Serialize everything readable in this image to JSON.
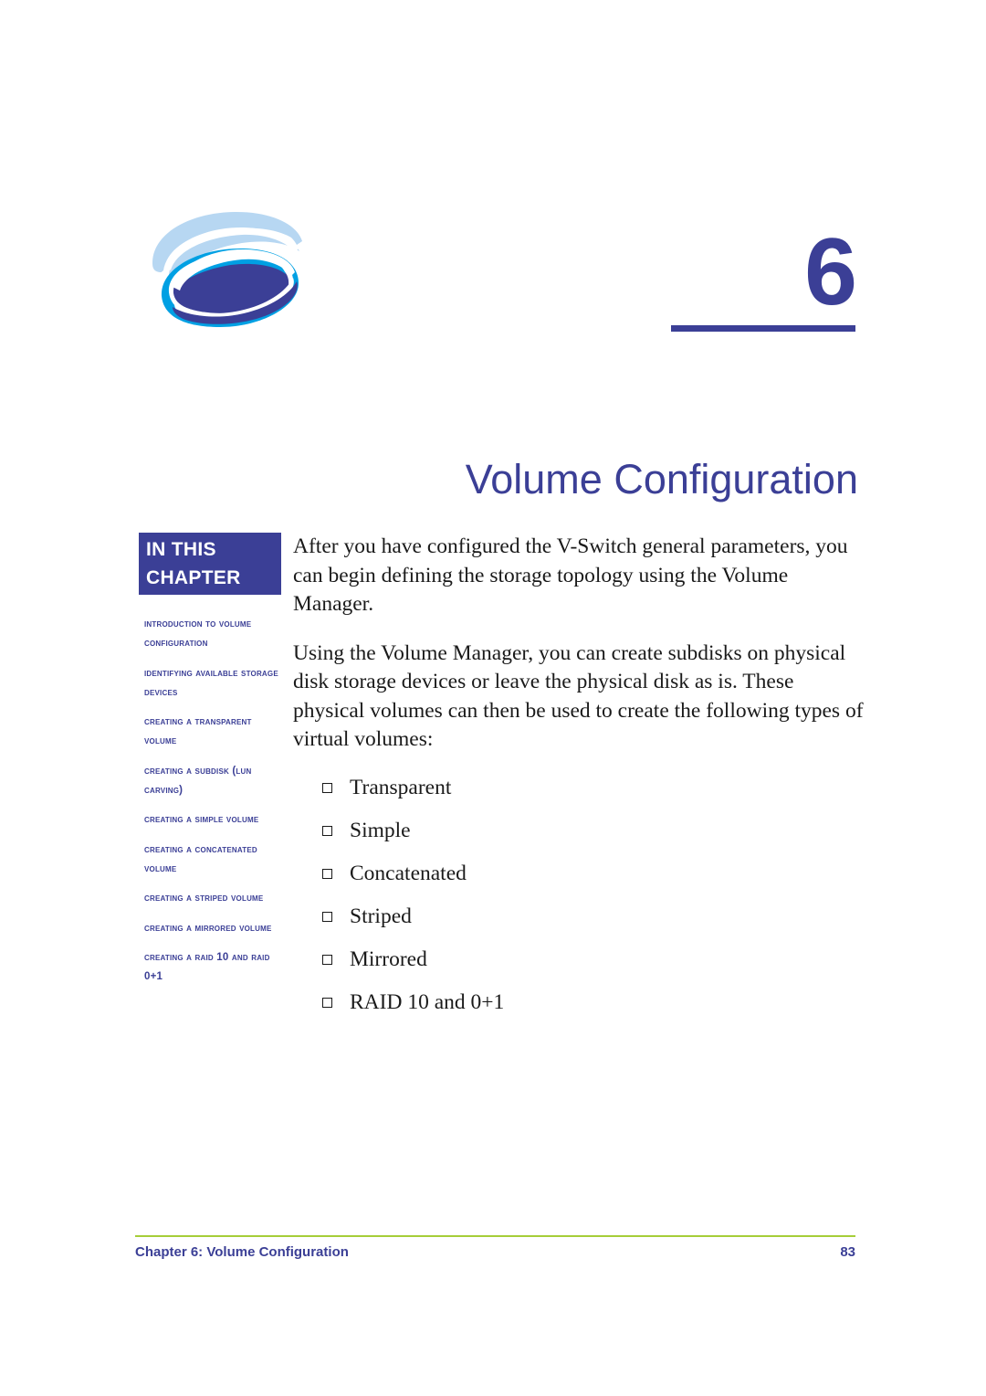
{
  "header": {
    "logo_name": "swirl-globe-logo",
    "chapter_number": "6"
  },
  "title": "Volume Configuration",
  "sidebar": {
    "heading_line1": "IN THIS",
    "heading_line2": "CHAPTER",
    "items": [
      "Introduction to Volume Configuration",
      "Identifying Available Storage Devices",
      "Creating a Transparent Volume",
      "Creating a Subdisk (LUN Carving)",
      "Creating a Simple Volume",
      "Creating a Concatenated Volume",
      "Creating a Striped Volume",
      "Creating a Mirrored Volume",
      "Creating a RAID 10 and RAID 0+1"
    ]
  },
  "main": {
    "paragraph1": "After you have configured the V-Switch general parameters, you can begin defining the storage topology using the Volume Manager.",
    "paragraph2": "Using the Volume Manager, you can create subdisks on physical disk storage devices or leave the physical disk as is.  These physical volumes can then be used to create the following types of virtual volumes:",
    "bullets": [
      "Transparent",
      "Simple",
      "Concatenated",
      "Striped",
      "Mirrored",
      "RAID 10 and 0+1"
    ]
  },
  "footer": {
    "left": "Chapter 6:  Volume Configuration",
    "page_number": "83"
  },
  "colors": {
    "navy": "#3b3f96",
    "rule_green": "#a6ce39",
    "logo_pale_blue": "#b7d7f2",
    "logo_cyan": "#00a0e3",
    "logo_navy": "#3b3f96"
  }
}
